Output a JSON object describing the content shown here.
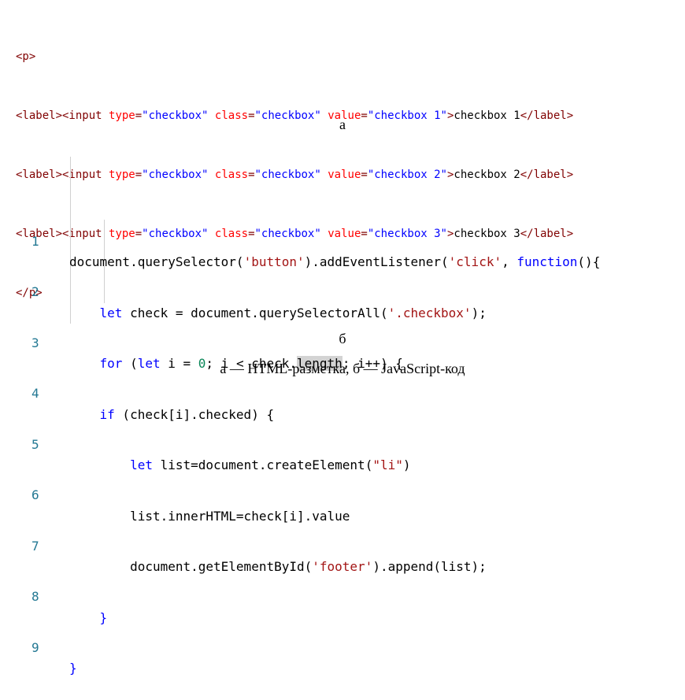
{
  "html_markup": {
    "line1": "<p>",
    "checkboxes": [
      {
        "value": "\"checkbox 1\"",
        "text": "checkbox 1"
      },
      {
        "value": "\"checkbox 2\"",
        "text": "checkbox 2"
      },
      {
        "value": "\"checkbox 3\"",
        "text": "checkbox 3"
      }
    ],
    "line5": "</p>"
  },
  "captions": {
    "a": "а",
    "b": "б",
    "main": "а — HTML-разметка, б — JavaScript-код"
  },
  "code": {
    "line_numbers": [
      "1",
      "2",
      "3",
      "4",
      "5",
      "6",
      "7",
      "8",
      "9"
    ]
  }
}
